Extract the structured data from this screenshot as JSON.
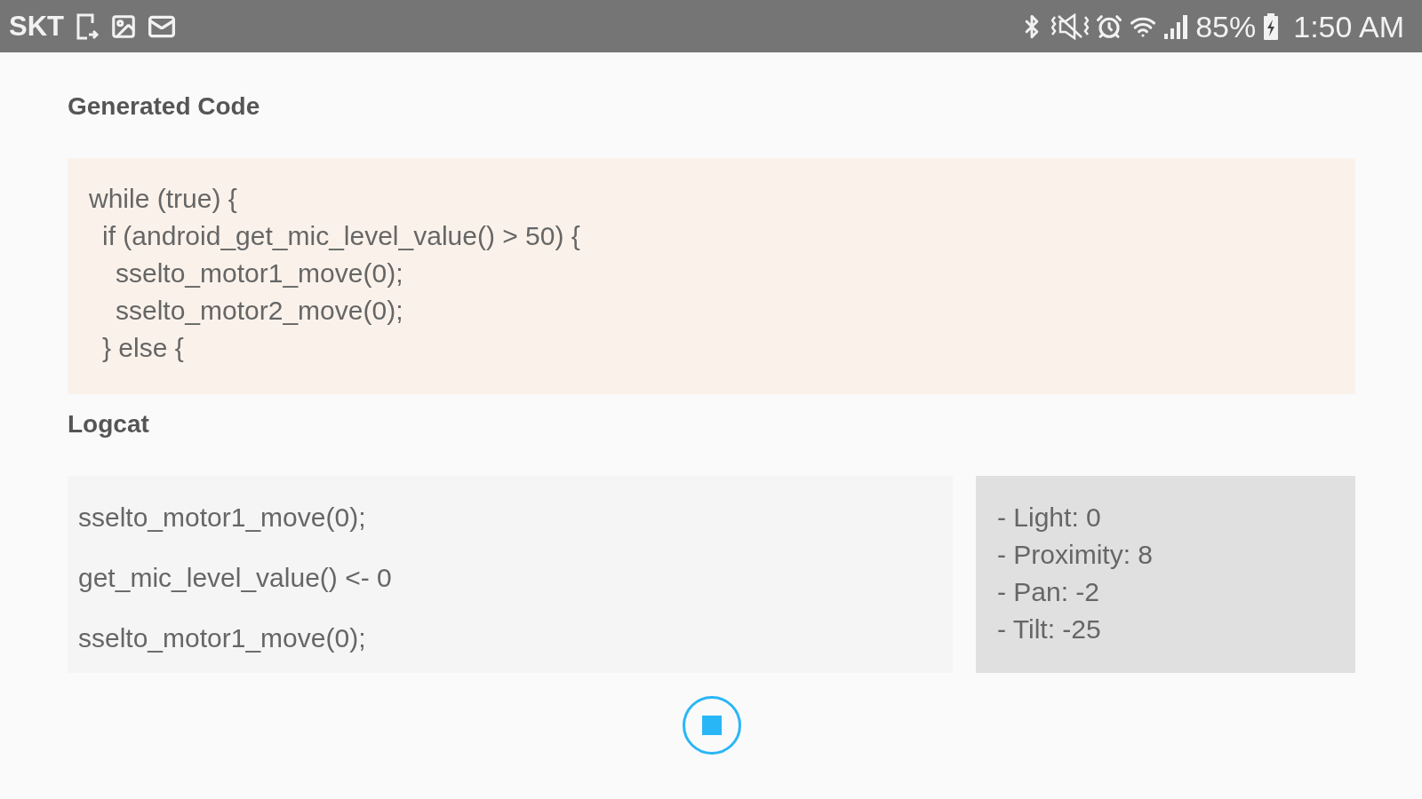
{
  "status_bar": {
    "carrier": "SKT",
    "battery": "85%",
    "time": "1:50 AM"
  },
  "generated_code": {
    "title": "Generated Code",
    "lines": [
      {
        "text": "while (true) {",
        "children": [
          {
            "text": "if (android_get_mic_level_value() > 50) {",
            "children": [
              {
                "text": "sselto_motor1_move(0);"
              },
              {
                "text": "sselto_motor2_move(0);"
              }
            ]
          },
          {
            "text": "} else {"
          }
        ]
      }
    ]
  },
  "logcat": {
    "title": "Logcat",
    "entries": [
      "sselto_motor1_move(0);",
      "get_mic_level_value() <- 0",
      "sselto_motor1_move(0);"
    ],
    "sensors": [
      "- Light: 0",
      "- Proximity: 8",
      "- Pan: -2",
      "- Tilt: -25"
    ]
  }
}
